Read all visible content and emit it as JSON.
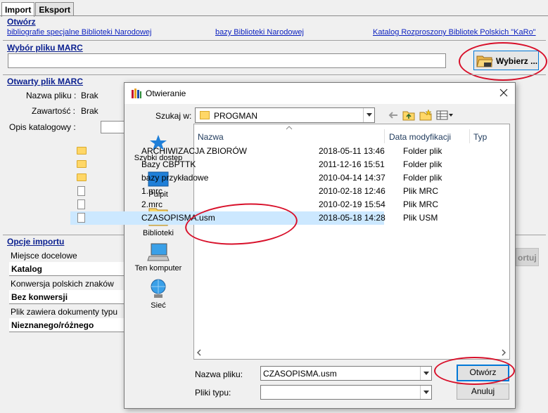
{
  "tabs": [
    {
      "label": "Import",
      "active": true
    },
    {
      "label": "Eksport",
      "active": false
    }
  ],
  "otworz": {
    "title": "Otwórz",
    "links": [
      "bibliografie specjalne Biblioteki Narodowej",
      "bazy Biblioteki Narodowej",
      "Katalog Rozproszony Bibliotek Polskich \"KaRo\""
    ]
  },
  "marc_choice": {
    "title": "Wybór pliku MARC",
    "path_value": "",
    "choose_button": "Wybierz ..."
  },
  "open_marc": {
    "title": "Otwarty plik MARC",
    "file_name_label": "Nazwa pliku :",
    "file_name_value": "Brak",
    "content_label": "Zawartość :",
    "content_value": "Brak",
    "catalog_desc_label": "Opis katalogowy :"
  },
  "import_options": {
    "title": "Opcje importu",
    "destination_label": "Miejsce docelowe",
    "destination_value": "Katalog",
    "conversion_label": "Konwersja polskich znaków",
    "conversion_value": "Bez konwersji",
    "doctype_label": "Plik zawiera dokumenty typu",
    "doctype_value": "Nieznanego/różnego",
    "import_button_partial": "ortuj"
  },
  "dialog": {
    "title": "Otwieranie",
    "lookin_label": "Szukaj w:",
    "lookin_value": "PROGMAN",
    "places": [
      "Szybki dostęp",
      "Pulpit",
      "Biblioteki",
      "Ten komputer",
      "Sieć"
    ],
    "columns": {
      "name": "Nazwa",
      "date": "Data modyfikacji",
      "type": "Typ"
    },
    "files": [
      {
        "name": "ARCHIWIZACJA ZBIORÓW",
        "date": "2018-05-11 13:46",
        "type": "Folder plik",
        "kind": "folder"
      },
      {
        "name": "Bazy CBPTTK",
        "date": "2011-12-16 15:51",
        "type": "Folder plik",
        "kind": "folder"
      },
      {
        "name": "bazy przykładowe",
        "date": "2010-04-14 14:37",
        "type": "Folder plik",
        "kind": "folder"
      },
      {
        "name": "1.mrc",
        "date": "2010-02-18 12:46",
        "type": "Plik MRC",
        "kind": "file"
      },
      {
        "name": "2.mrc",
        "date": "2010-02-19 15:54",
        "type": "Plik MRC",
        "kind": "file"
      },
      {
        "name": "CZASOPISMA.usm",
        "date": "2018-05-18 14:28",
        "type": "Plik USM",
        "kind": "file",
        "selected": true
      }
    ],
    "filename_label": "Nazwa pliku:",
    "filename_value": "CZASOPISMA.usm",
    "filetype_label": "Pliki typu:",
    "filetype_value": "",
    "open_button": "Otwórz",
    "cancel_button": "Anuluj"
  },
  "colors": {
    "link": "#0a1fbf",
    "annotation_red": "#d8102a",
    "selection": "#cce8ff",
    "accent": "#0078d7"
  }
}
